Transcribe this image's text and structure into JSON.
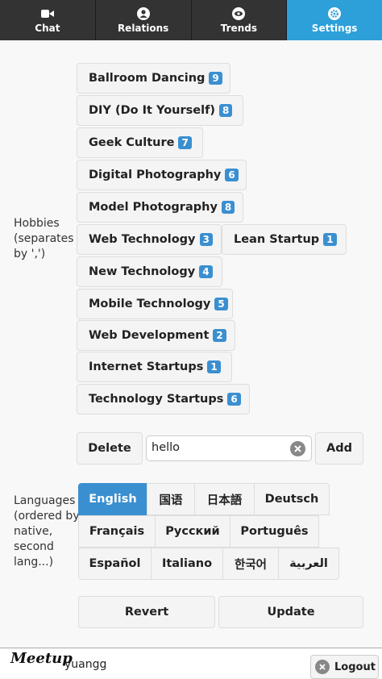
{
  "nav": {
    "tabs": [
      {
        "label": "Chat",
        "icon": "video-camera-icon"
      },
      {
        "label": "Relations",
        "icon": "person-icon"
      },
      {
        "label": "Trends",
        "icon": "eye-icon"
      },
      {
        "label": "Settings",
        "icon": "gear-icon",
        "active": true
      }
    ]
  },
  "hobbies": {
    "label": "Hobbies (separates by ',')",
    "items": [
      {
        "name": "Ballroom Dancing",
        "count": "9"
      },
      {
        "name": "DIY (Do It Yourself)",
        "count": "8"
      },
      {
        "name": "Geek Culture",
        "count": "7"
      },
      {
        "name": "Digital Photography",
        "count": "6"
      },
      {
        "name": "Model Photography",
        "count": "8"
      },
      {
        "name": "Web Technology",
        "count": "3"
      },
      {
        "name": "Lean Startup",
        "count": "1"
      },
      {
        "name": "New Technology",
        "count": "4"
      },
      {
        "name": "Mobile Technology",
        "count": "5"
      },
      {
        "name": "Web Development",
        "count": "2"
      },
      {
        "name": "Internet Startups",
        "count": "1"
      },
      {
        "name": "Technology Startups",
        "count": "6"
      }
    ],
    "delete_label": "Delete",
    "input_value": "hello",
    "add_label": "Add"
  },
  "languages": {
    "label": "Languages (ordered by native, second lang...)",
    "items": [
      "English",
      "国语",
      "日本語",
      "Deutsch",
      "Français",
      "Русский",
      "Português",
      "Español",
      "Italiano",
      "한국어",
      "العربية"
    ],
    "active": "English"
  },
  "actions": {
    "revert_label": "Revert",
    "update_label": "Update"
  },
  "footer": {
    "logo": "Meetup",
    "username": "yuangg",
    "logout_label": "Logout"
  },
  "colors": {
    "accent": "#2d9fd9",
    "badge": "#3a8fd0",
    "nav_bg": "#333333"
  }
}
